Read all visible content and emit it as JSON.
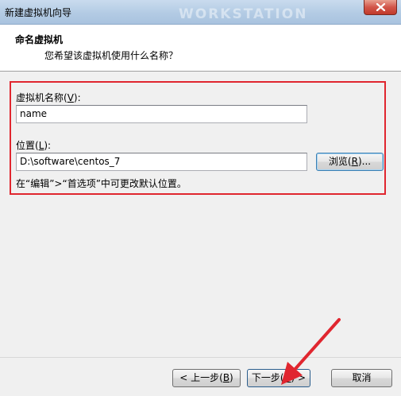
{
  "window": {
    "title": "新建虚拟机向导",
    "watermark": "WORKSTATION"
  },
  "header": {
    "title": "命名虚拟机",
    "subtitle": "您希望该虚拟机使用什么名称？"
  },
  "form": {
    "name_label_prefix": "虚拟机名称(",
    "name_label_key": "V",
    "name_label_suffix": "):",
    "name_value": "name",
    "location_label_prefix": "位置(",
    "location_label_key": "L",
    "location_label_suffix": "):",
    "location_value": "D:\\software\\centos_7",
    "browse_prefix": "浏览(",
    "browse_key": "R",
    "browse_suffix": ")...",
    "hint": "在“编辑”>“首选项”中可更改默认位置。"
  },
  "footer": {
    "back_prefix": "< 上一步(",
    "back_key": "B",
    "back_suffix": ")",
    "next_prefix": "下一步(",
    "next_key": "N",
    "next_suffix": ") >",
    "cancel_label": "取消"
  },
  "colors": {
    "highlight": "#e0262f",
    "arrow": "#e0262f"
  },
  "icons": [
    "close-icon",
    "red-arrow-annotation"
  ]
}
